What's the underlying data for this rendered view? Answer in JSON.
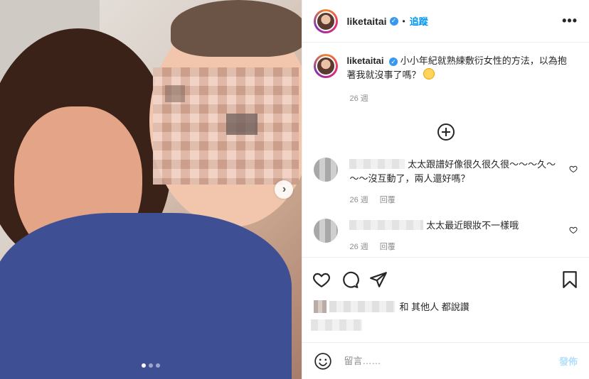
{
  "header": {
    "username": "liketaitai",
    "separator": "•",
    "follow_label": "追蹤",
    "more_label": "•••"
  },
  "caption": {
    "username": "liketaitai",
    "text": "小小年紀就熟練敷衍女性的方法，以為抱著我就沒事了嗎？",
    "time": "26 週"
  },
  "comments": [
    {
      "text": "太太跟譜好像很久很久很～～～久～～～沒互動了，兩人還好嗎？",
      "time": "26 週",
      "reply_label": "回覆"
    },
    {
      "text": "太太最近眼妝不一樣哦",
      "time": "26 週",
      "reply_label": "回覆"
    }
  ],
  "likes": {
    "text": "和 其他人 都說讚"
  },
  "add_comment": {
    "placeholder": "留言……",
    "post_label": "發佈"
  },
  "media": {
    "next_label": "›",
    "carousel_count": 3,
    "carousel_active_index": 0
  },
  "colors": {
    "accent": "#0095f6",
    "verified": "#3897f0",
    "post_disabled": "#b2dffc"
  },
  "icons": [
    "verified-badge-icon",
    "more-options-icon",
    "load-more-icon",
    "heart-icon",
    "comment-icon",
    "share-icon",
    "bookmark-icon",
    "emoji-icon",
    "chevron-right-icon"
  ]
}
